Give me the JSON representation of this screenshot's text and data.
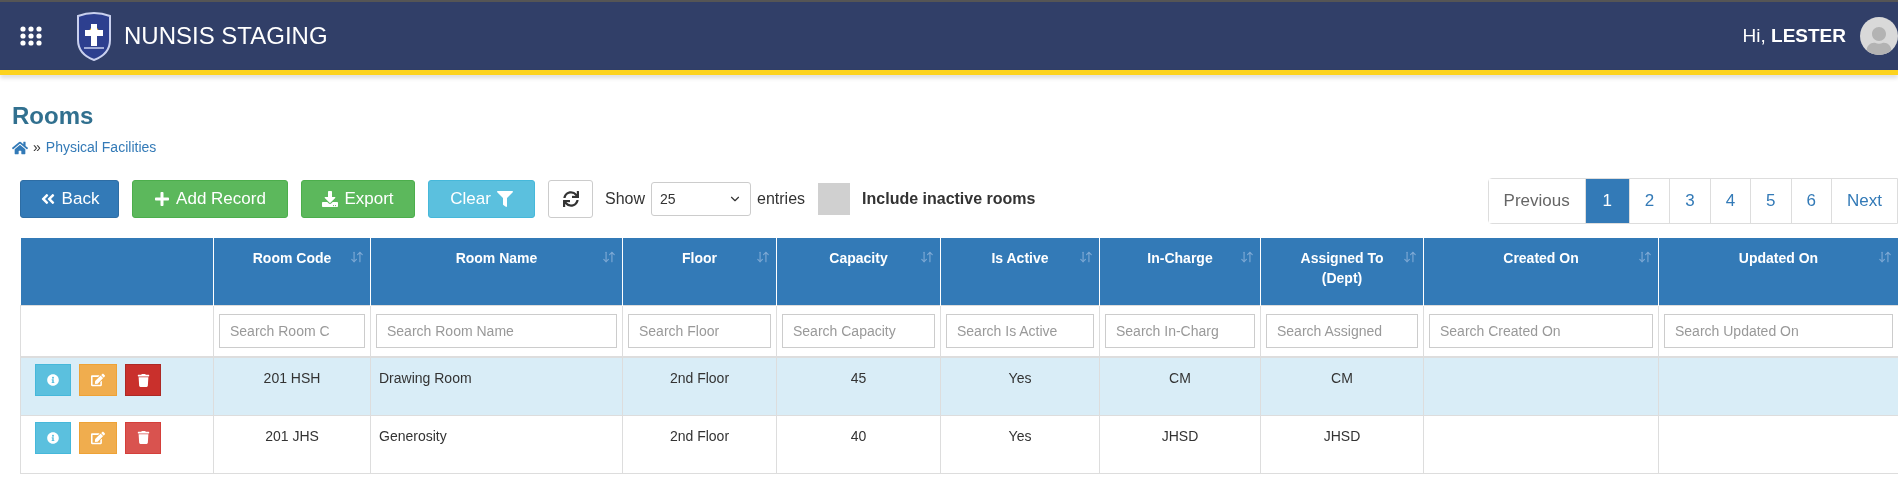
{
  "header": {
    "brand": "NUNSIS STAGING",
    "greeting": "Hi, **LESTER**"
  },
  "page": {
    "title": "Rooms",
    "breadcrumb_separator": "»",
    "breadcrumb": [
      "Physical Facilities"
    ]
  },
  "toolbar": {
    "buttons": [
      {
        "kind": "back",
        "label": "Back"
      },
      {
        "kind": "add",
        "label": "Add Record"
      },
      {
        "kind": "export",
        "label": "Export"
      },
      {
        "kind": "clear",
        "label": "Clear"
      }
    ],
    "show_label": "Show",
    "page_size": "25",
    "entries_label": "entries",
    "include_inactive": {
      "label": "Include inactive rooms",
      "checked": false
    }
  },
  "pagination": [
    {
      "label": "Previous",
      "selected": false
    },
    {
      "label": "1",
      "selected": true
    },
    {
      "label": "2",
      "selected": false
    },
    {
      "label": "3",
      "selected": false
    },
    {
      "label": "4",
      "selected": false
    },
    {
      "label": "5",
      "selected": false
    },
    {
      "label": "6",
      "selected": false
    },
    {
      "label": "Next",
      "selected": false
    }
  ],
  "table": {
    "columns": [
      "Room Code",
      "Room Name",
      "Floor",
      "Capacity",
      "Is Active",
      "In-Charge",
      "Assigned To (Dept)",
      "Created On",
      "Updated On"
    ],
    "filters": [
      {
        "placeholder": "Search Room C"
      },
      {
        "placeholder": "Search Room Name"
      },
      {
        "placeholder": "Search Floor"
      },
      {
        "placeholder": "Search Capacity"
      },
      {
        "placeholder": "Search Is Active"
      },
      {
        "placeholder": "Search In-Charg"
      },
      {
        "placeholder": "Search Assigned"
      },
      {
        "placeholder": "Search Created On"
      },
      {
        "placeholder": "Search Updated On"
      }
    ],
    "rows": [
      {
        "selected": true,
        "delete_hovered": true,
        "cells": [
          "201 HSH",
          "Drawing Room",
          "2nd Floor",
          "45",
          "Yes",
          "CM",
          "CM"
        ]
      },
      {
        "selected": false,
        "delete_hovered": false,
        "cells": [
          "201 JHS",
          "Generosity",
          "2nd Floor",
          "40",
          "Yes",
          "JHSD",
          "JHSD"
        ]
      }
    ]
  }
}
